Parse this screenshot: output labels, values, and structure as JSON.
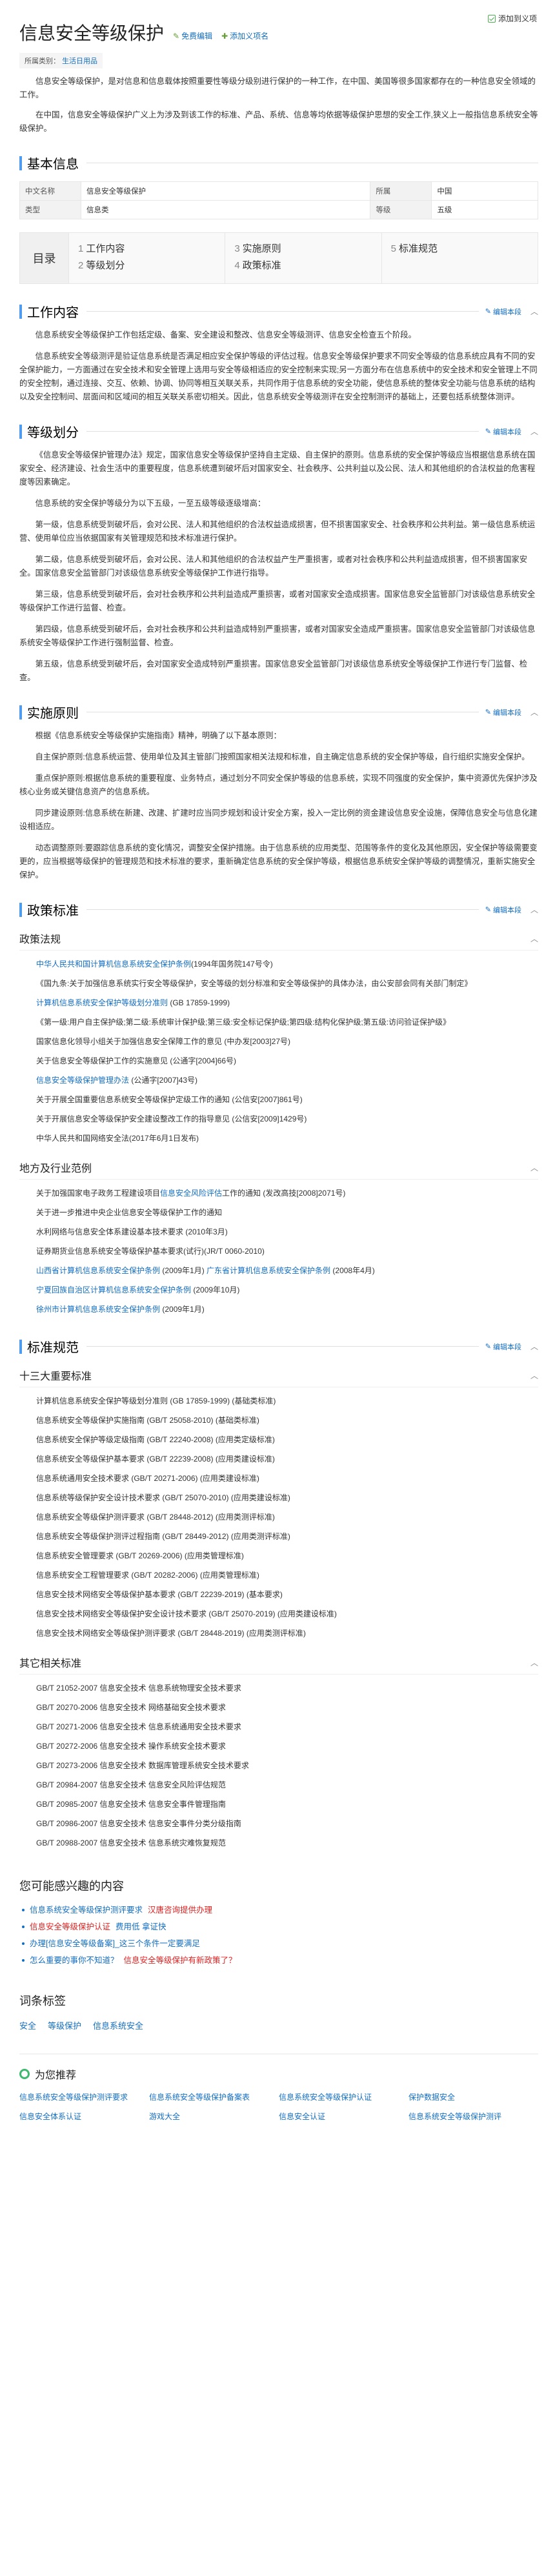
{
  "top_action": "添加到义项",
  "title": "信息安全等级保护",
  "title_links": [
    "免费编辑",
    "添加义项名"
  ],
  "category": {
    "label": "所属类别：",
    "value": "生活日用品"
  },
  "intro": [
    "信息安全等级保护，是对信息和信息载体按照重要性等级分级别进行保护的一种工作，在中国、美国等很多国家都存在的一种信息安全领域的工作。",
    "在中国，信息安全等级保护广义上为涉及到该工作的标准、产品、系统、信息等均依据等级保护思想的安全工作,狭义上一般指信息系统安全等级保护。"
  ],
  "basic_info": {
    "heading": "基本信息",
    "rows": [
      [
        {
          "k": "中文名称",
          "v": "信息安全等级保护"
        },
        {
          "k": "所属",
          "v": "中国"
        }
      ],
      [
        {
          "k": "类型",
          "v": "信息类"
        },
        {
          "k": "等级",
          "v": "五级"
        }
      ]
    ]
  },
  "toc": {
    "label": "目录",
    "columns": [
      [
        {
          "n": "1",
          "t": "工作内容"
        },
        {
          "n": "2",
          "t": "等级划分"
        }
      ],
      [
        {
          "n": "3",
          "t": "实施原则"
        },
        {
          "n": "4",
          "t": "政策标准"
        }
      ],
      [
        {
          "n": "5",
          "t": "标准规范"
        }
      ]
    ]
  },
  "edit_label": "编辑本段",
  "sections": {
    "work": {
      "heading": "工作内容",
      "paras": [
        "信息系统安全等级保护工作包括定级、备案、安全建设和整改、信息安全等级测评、信息安全检查五个阶段。",
        "信息系统安全等级测评是验证信息系统是否满足相应安全保护等级的评估过程。信息安全等级保护要求不同安全等级的信息系统应具有不同的安全保护能力，一方面通过在安全技术和安全管理上选用与安全等级相适应的安全控制来实现;另一方面分布在信息系统中的安全技术和安全管理上不同的安全控制，通过连接、交互、依赖、协调、协同等相互关联关系，共同作用于信息系统的安全功能，使信息系统的整体安全功能与信息系统的结构以及安全控制间、层面间和区域间的相互关联关系密切相关。因此，信息系统安全等级测评在安全控制测评的基础上，还要包括系统整体测评。"
      ]
    },
    "grade": {
      "heading": "等级划分",
      "paras": [
        "《信息安全等级保护管理办法》规定，国家信息安全等级保护坚持自主定级、自主保护的原则。信息系统的安全保护等级应当根据信息系统在国家安全、经济建设、社会生活中的重要程度，信息系统遭到破坏后对国家安全、社会秩序、公共利益以及公民、法人和其他组织的合法权益的危害程度等因素确定。",
        "信息系统的安全保护等级分为以下五级，一至五级等级逐级增高：",
        "第一级，信息系统受到破坏后，会对公民、法人和其他组织的合法权益造成损害，但不损害国家安全、社会秩序和公共利益。第一级信息系统运营、使用单位应当依据国家有关管理规范和技术标准进行保护。",
        "第二级，信息系统受到破坏后，会对公民、法人和其他组织的合法权益产生严重损害，或者对社会秩序和公共利益造成损害，但不损害国家安全。国家信息安全监管部门对该级信息系统安全等级保护工作进行指导。",
        "第三级，信息系统受到破坏后，会对社会秩序和公共利益造成严重损害，或者对国家安全造成损害。国家信息安全监管部门对该级信息系统安全等级保护工作进行监督、检查。",
        "第四级，信息系统受到破坏后，会对社会秩序和公共利益造成特别严重损害，或者对国家安全造成严重损害。国家信息安全监管部门对该级信息系统安全等级保护工作进行强制监督、检查。",
        "第五级，信息系统受到破坏后，会对国家安全造成特别严重损害。国家信息安全监管部门对该级信息系统安全等级保护工作进行专门监督、检查。"
      ]
    },
    "principle": {
      "heading": "实施原则",
      "paras": [
        "根据《信息系统安全等级保护实施指南》精神，明确了以下基本原则：",
        "自主保护原则:信息系统运营、使用单位及其主管部门按照国家相关法规和标准，自主确定信息系统的安全保护等级，自行组织实施安全保护。",
        "重点保护原则:根据信息系统的重要程度、业务特点，通过划分不同安全保护等级的信息系统，实现不同强度的安全保护，集中资源优先保护涉及核心业务或关键信息资产的信息系统。",
        "同步建设原则:信息系统在新建、改建、扩建时应当同步规划和设计安全方案，投入一定比例的资金建设信息安全设施，保障信息安全与信息化建设相适应。",
        "动态调整原则:要跟踪信息系统的变化情况，调整安全保护措施。由于信息系统的应用类型、范围等条件的变化及其他原因，安全保护等级需要变更的，应当根据等级保护的管理规范和技术标准的要求，重新确定信息系统的安全保护等级，根据信息系统安全保护等级的调整情况，重新实施安全保护。"
      ]
    },
    "policy": {
      "heading": "政策标准",
      "sub1": {
        "title": "政策法规",
        "items": [
          {
            "a": "中华人民共和国计算机信息系统安全保护条例",
            "t": "(1994年国务院147号令)"
          },
          {
            "a": "",
            "t": "《国九条:关于加强信息系统实行安全等级保护，安全等级的划分标准和安全等级保护的具体办法，由公安部会同有关部门制定》"
          },
          {
            "a": "计算机信息系统安全保护等级划分准则",
            "t": " (GB 17859-1999)"
          },
          {
            "a": "",
            "t": "《第一级:用户自主保护级;第二级:系统审计保护级;第三级:安全标记保护级;第四级:结构化保护级;第五级:访问验证保护级》"
          },
          {
            "a": "",
            "t": "国家信息化领导小组关于加强信息安全保障工作的意见 (中办发[2003]27号)"
          },
          {
            "a": "",
            "t": "关于信息安全等级保护工作的实施意见 (公通字[2004]66号)"
          },
          {
            "a": "信息安全等级保护管理办法",
            "t": " (公通字[2007]43号)"
          },
          {
            "a": "",
            "t": "关于开展全国重要信息系统安全等级保护定级工作的通知 (公信安[2007]861号)"
          },
          {
            "a": "",
            "t": "关于开展信息安全等级保护安全建设整改工作的指导意见 (公信安[2009]1429号)"
          },
          {
            "a": "",
            "t": "中华人民共和国网络安全法(2017年6月1日发布)"
          }
        ]
      },
      "sub2": {
        "title": "地方及行业范例",
        "items": [
          {
            "a": "",
            "t": "关于加强国家电子政务工程建设项目",
            "a2": "信息安全风险评估",
            "t2": "工作的通知 (发改高技[2008]2071号)"
          },
          {
            "a": "",
            "t": "关于进一步推进中央企业信息安全等级保护工作的通知"
          },
          {
            "a": "",
            "t": "水利网络与信息安全体系建设基本技术要求 (2010年3月)"
          },
          {
            "a": "",
            "t": "证券期货业信息系统安全等级保护基本要求(试行)(JR/T 0060-2010)"
          },
          {
            "a": "山西省计算机信息系统安全保护条例",
            "t": " (2009年1月) ",
            "a2": "广东省计算机信息系统安全保护条例",
            "t2": " (2008年4月)"
          },
          {
            "a": "宁夏回族自治区计算机信息系统安全保护条例",
            "t": " (2009年10月)"
          },
          {
            "a": "徐州市计算机信息系统安全保护条例",
            "t": " (2009年1月)"
          }
        ]
      }
    },
    "standard": {
      "heading": "标准规范",
      "sub1": {
        "title": "十三大重要标准",
        "items": [
          "计算机信息系统安全保护等级划分准则 (GB 17859-1999) (基础类标准)",
          "信息系统安全等级保护实施指南 (GB/T 25058-2010) (基础类标准)",
          "信息系统安全保护等级定级指南 (GB/T 22240-2008) (应用类定级标准)",
          "信息系统安全等级保护基本要求 (GB/T 22239-2008) (应用类建设标准)",
          "信息系统通用安全技术要求 (GB/T 20271-2006) (应用类建设标准)",
          "信息系统等级保护安全设计技术要求 (GB/T 25070-2010) (应用类建设标准)",
          "信息系统安全等级保护测评要求 (GB/T 28448-2012) (应用类测评标准)",
          "信息系统安全等级保护测评过程指南 (GB/T 28449-2012) (应用类测评标准)",
          "信息系统安全管理要求 (GB/T 20269-2006) (应用类管理标准)",
          "信息系统安全工程管理要求 (GB/T 20282-2006) (应用类管理标准)",
          "信息安全技术网络安全等级保护基本要求 (GB/T 22239-2019) (基本要求)",
          "信息安全技术网络安全等级保护安全设计技术要求 (GB/T 25070-2019) (应用类建设标准)",
          "信息安全技术网络安全等级保护测评要求 (GB/T 28448-2019) (应用类测评标准)"
        ]
      },
      "sub2": {
        "title": "其它相关标准",
        "items": [
          "GB/T 21052-2007 信息安全技术 信息系统物理安全技术要求",
          "GB/T 20270-2006 信息安全技术 网络基础安全技术要求",
          "GB/T 20271-2006 信息安全技术 信息系统通用安全技术要求",
          "GB/T 20272-2006 信息安全技术 操作系统安全技术要求",
          "GB/T 20273-2006 信息安全技术 数据库管理系统安全技术要求",
          "GB/T 20984-2007 信息安全技术 信息安全风险评估规范",
          "GB/T 20985-2007 信息安全技术 信息安全事件管理指南",
          "GB/T 20986-2007 信息安全技术 信息安全事件分类分级指南",
          "GB/T 20988-2007 信息安全技术 信息系统灾难恢复规范"
        ]
      }
    }
  },
  "interest": {
    "heading": "您可能感兴趣的内容",
    "items": [
      {
        "a": "信息系统安全等级保护测评要求",
        "red": "汉唐咨询提供办理"
      },
      {
        "a": "",
        "red": "信息安全等级保护认证",
        "b": "费用低 拿证快"
      },
      {
        "a": "办理[信息安全等级备案]_这三个条件一定要满足",
        "red": ""
      },
      {
        "a": "怎么重要的事你不知道？",
        "red": "信息安全等级保护有新政策了？"
      }
    ]
  },
  "tags": {
    "heading": "词条标签",
    "items": [
      "安全",
      "等级保护",
      "信息系统安全"
    ]
  },
  "recommend": {
    "heading": "为您推荐",
    "items": [
      "信息系统安全等级保护测评要求",
      "信息系统安全等级保护备案表",
      "信息系统安全等级保护认证",
      "保护数据安全",
      "信息安全体系认证",
      "游戏大全",
      "信息安全认证",
      "信息系统安全等级保护测评"
    ]
  }
}
